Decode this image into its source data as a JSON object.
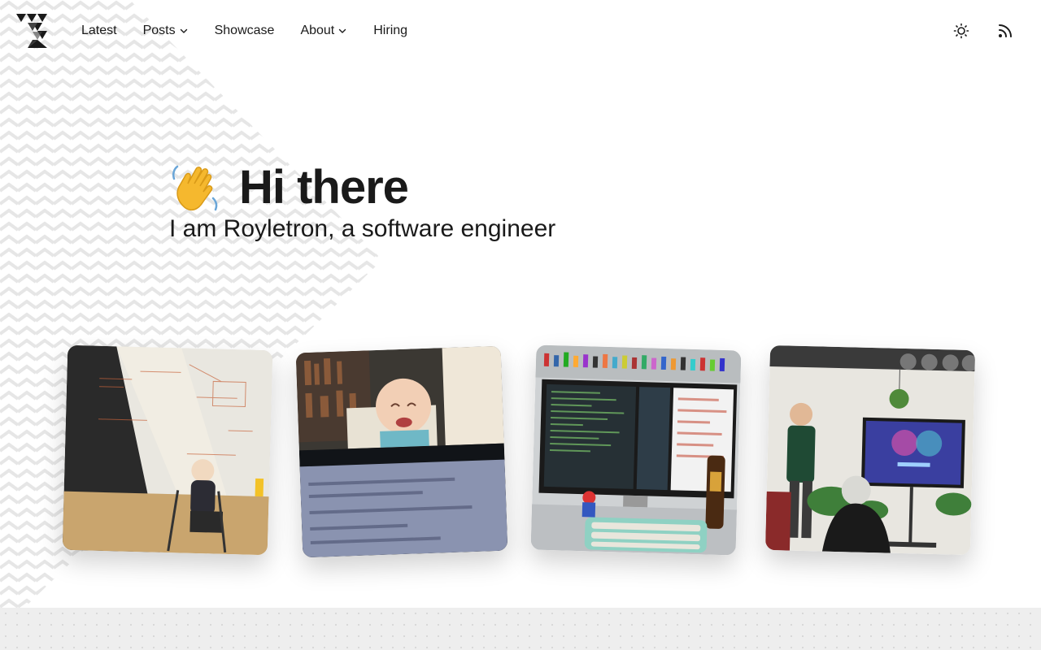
{
  "header": {
    "nav": {
      "latest": "Latest",
      "posts": "Posts",
      "showcase": "Showcase",
      "about": "About",
      "hiring": "Hiring"
    },
    "icons": {
      "logo": "triangle-logo-icon",
      "theme": "sun-icon",
      "rss": "rss-icon",
      "dropdown": "chevron-down-icon"
    }
  },
  "hero": {
    "emoji": "👋",
    "title": "Hi there",
    "subtitle": "I am Royletron, a software engineer"
  },
  "photos": [
    {
      "subject": "child at whiteboard"
    },
    {
      "subject": "crying baby behind laptop"
    },
    {
      "subject": "desk with monitor, figures and keyboard"
    },
    {
      "subject": "presentation with screen"
    }
  ],
  "colors": {
    "text": "#1a1a1a",
    "background": "#ffffff",
    "footer_band": "#eeeeee",
    "pattern": "#e6e6e6"
  }
}
